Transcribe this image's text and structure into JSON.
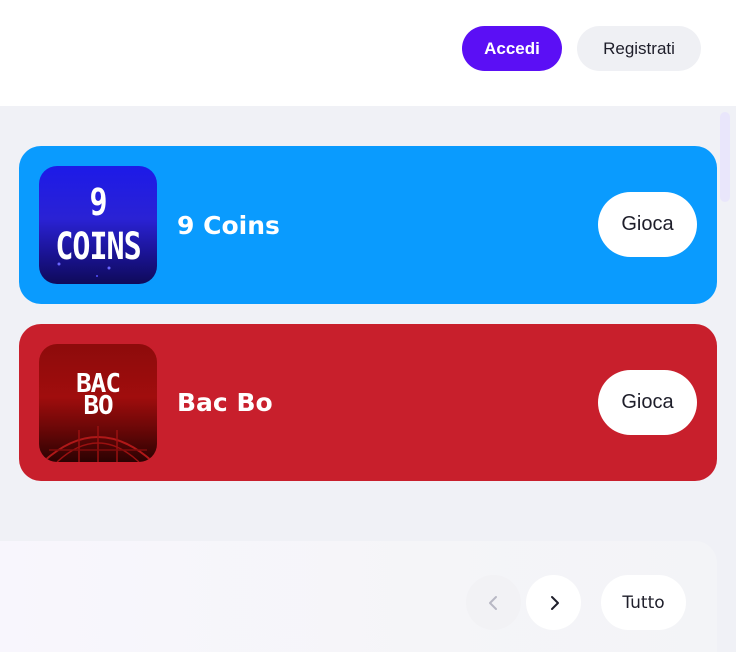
{
  "header": {
    "login_label": "Accedi",
    "register_label": "Registrati",
    "login_color": "#5b0ff5"
  },
  "games": [
    {
      "thumb_text": "9 COINS",
      "title": "9 Coins",
      "play_label": "Gioca",
      "card_color": "#0a9bfe"
    },
    {
      "thumb_text_line1": "BAC",
      "thumb_text_line2": "BO",
      "title": "Bac Bo",
      "play_label": "Gioca",
      "card_color": "#c81f2c"
    }
  ],
  "carousel_nav": {
    "prev_icon": "chevron-left-icon",
    "next_icon": "chevron-right-icon",
    "all_label": "Tutto"
  }
}
